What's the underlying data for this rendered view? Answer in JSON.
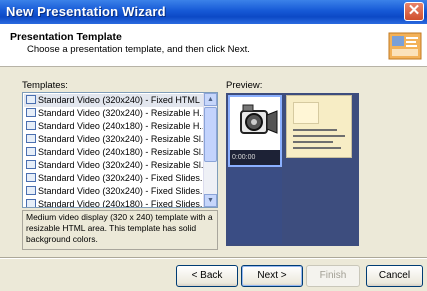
{
  "window": {
    "title": "New Presentation Wizard",
    "close_glyph": "✕"
  },
  "header": {
    "title": "Presentation Template",
    "subtitle": "Choose a presentation template, and then click Next."
  },
  "templates": {
    "label": "Templates:",
    "items": [
      "Standard Video (320x240) - Fixed HTML",
      "Standard Video (320x240) - Resizable H...",
      "Standard Video (240x180) - Resizable H...",
      "Standard Video (320x240) - Resizable Sl...",
      "Standard Video (240x180) - Resizable Sl...",
      "Standard Video (320x240) - Resizable Sl...",
      "Standard Video (320x240) - Fixed Slides...",
      "Standard Video (320x240) - Fixed Slides...",
      "Standard Video (240x180) - Fixed Slides..."
    ],
    "selected_index": 0,
    "scroll_up": "▲",
    "scroll_down": "▼"
  },
  "description": "Medium video display (320 x 240) template with a resizable HTML area. This template has solid background colors.",
  "preview": {
    "label": "Preview:",
    "timecode": "0:00:00"
  },
  "buttons": {
    "back": "< Back",
    "next": "Next >",
    "finish": "Finish",
    "cancel": "Cancel"
  },
  "colors": {
    "titlebar": "#0c49c6",
    "preview_bg": "#3d4d7e",
    "slide_bg": "#f7edc5"
  }
}
